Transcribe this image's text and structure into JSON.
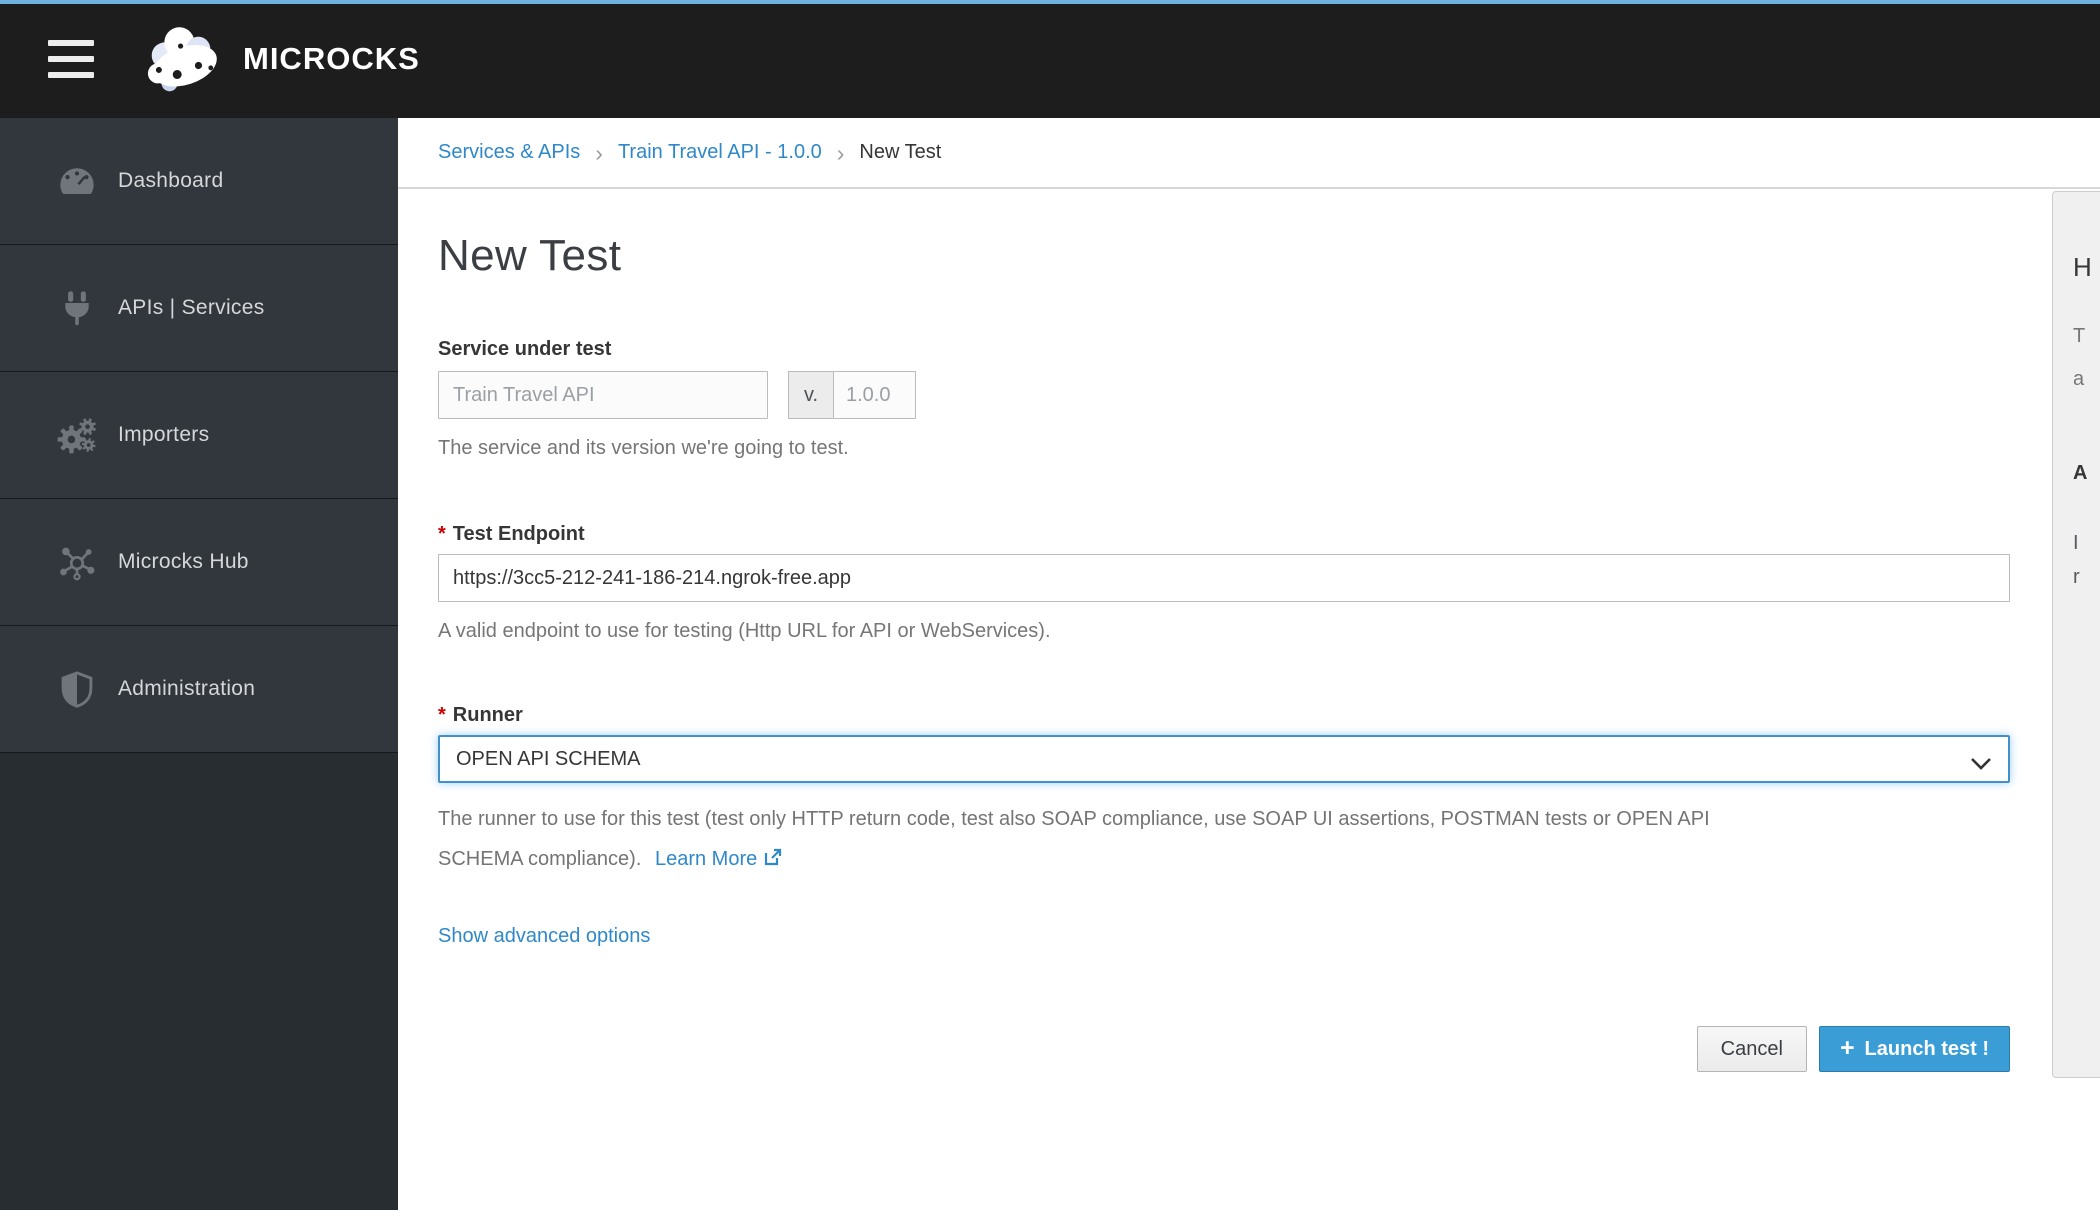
{
  "topbar": {
    "brand": "MICROCKS"
  },
  "sidebar": {
    "items": [
      {
        "label": "Dashboard",
        "icon": "dashboard-gauge-icon"
      },
      {
        "label": "APIs | Services",
        "icon": "plug-icon"
      },
      {
        "label": "Importers",
        "icon": "gears-icon"
      },
      {
        "label": "Microcks Hub",
        "icon": "hub-network-icon"
      },
      {
        "label": "Administration",
        "icon": "shield-icon"
      }
    ]
  },
  "breadcrumb": {
    "separator": "›",
    "items": [
      {
        "label": "Services & APIs",
        "link": true
      },
      {
        "label": "Train Travel API - 1.0.0",
        "link": true
      },
      {
        "label": "New Test",
        "link": false
      }
    ]
  },
  "page": {
    "title": "New Test"
  },
  "form": {
    "required_marker": "*",
    "service": {
      "label": "Service under test",
      "value": "Train Travel API",
      "version_prefix": "v.",
      "version": "1.0.0",
      "help": "The service and its version we're going to test."
    },
    "endpoint": {
      "label": "Test Endpoint",
      "value": "https://3cc5-212-241-186-214.ngrok-free.app",
      "help": "A valid endpoint to use for testing (Http URL for API or WebServices)."
    },
    "runner": {
      "label": "Runner",
      "value": "OPEN API SCHEMA",
      "help_line1": "The runner to use for this test (test only HTTP return code, test also SOAP compliance, use SOAP UI assertions, POSTMAN tests or OPEN API",
      "help_line2": "SCHEMA compliance).",
      "learn_more_label": "Learn More"
    },
    "advanced_options_label": "Show advanced options"
  },
  "actions": {
    "cancel_label": "Cancel",
    "launch_plus": "+",
    "launch_label": "Launch test !"
  },
  "right_panel": {
    "visible_text_fragments": [
      {
        "text": "H"
      },
      {
        "text": "T"
      },
      {
        "text": "a"
      },
      {
        "text": "A"
      },
      {
        "text": "I"
      },
      {
        "text": "r"
      }
    ]
  },
  "colors": {
    "accent_blue": "#2f88c9",
    "launch_button": "#3a9dd6",
    "navbar_bg": "#1d1d1d",
    "sidebar_bg": "#31373d",
    "top_strip": "#70b2de",
    "required_red": "#cc0000",
    "focus_border": "#4190ca"
  }
}
